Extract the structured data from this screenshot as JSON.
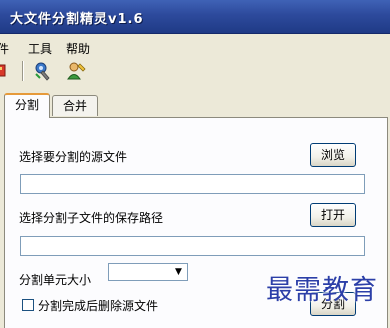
{
  "window": {
    "title": "大文件分割精灵v1.6"
  },
  "menubar": {
    "items": [
      "文件",
      "工具",
      "帮助"
    ],
    "visible_labels": [
      "件",
      "工具",
      "帮助"
    ]
  },
  "toolbar": {
    "icons": [
      "save-icon",
      "settings-tool-icon",
      "user-info-icon"
    ]
  },
  "tabs": [
    {
      "label": "分割",
      "active": true
    },
    {
      "label": "合并",
      "active": false
    }
  ],
  "split_panel": {
    "source_label": "选择要分割的源文件",
    "browse_button": "浏览",
    "source_value": "",
    "save_path_label": "选择分割子文件的保存路径",
    "open_button": "打开",
    "save_path_value": "",
    "unit_label": "分割单元大小",
    "unit_value": "",
    "delete_checkbox_label": "分割完成后删除源文件",
    "delete_checked": false,
    "split_button": "分割"
  },
  "watermark": {
    "text": "最需教育"
  },
  "colors": {
    "titlebar": "#2d4a9c",
    "window_bg": "#ece9d8",
    "panel_bg": "#fcfcfe",
    "active_tab_accent": "#e69a3a",
    "watermark": "#2c3fa8"
  }
}
